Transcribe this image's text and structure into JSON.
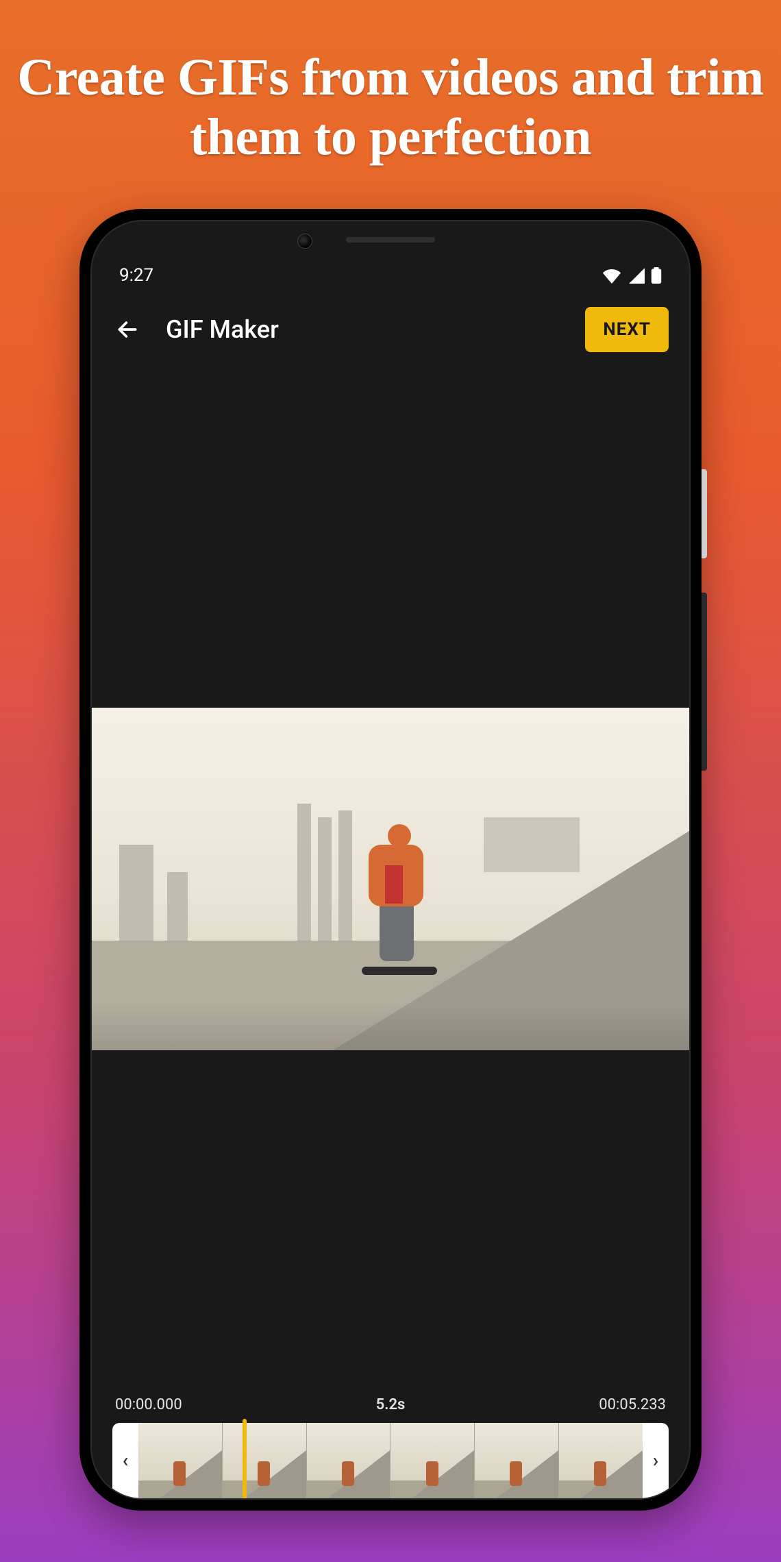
{
  "marketing": {
    "headline": "Create GIFs from videos and trim them to perfection"
  },
  "status_bar": {
    "time": "9:27"
  },
  "app_bar": {
    "title": "GIF Maker",
    "next_label": "NEXT"
  },
  "trim": {
    "start_time": "00:00.000",
    "duration": "5.2s",
    "end_time": "00:05.233",
    "handle_left_glyph": "‹",
    "handle_right_glyph": "›",
    "thumb_count": 6
  },
  "icons": {
    "back": "arrow-left",
    "wifi": "wifi",
    "signal": "cell-signal",
    "battery": "battery-full"
  },
  "colors": {
    "accent": "#f2b90d",
    "app_bg": "#1a1919"
  }
}
